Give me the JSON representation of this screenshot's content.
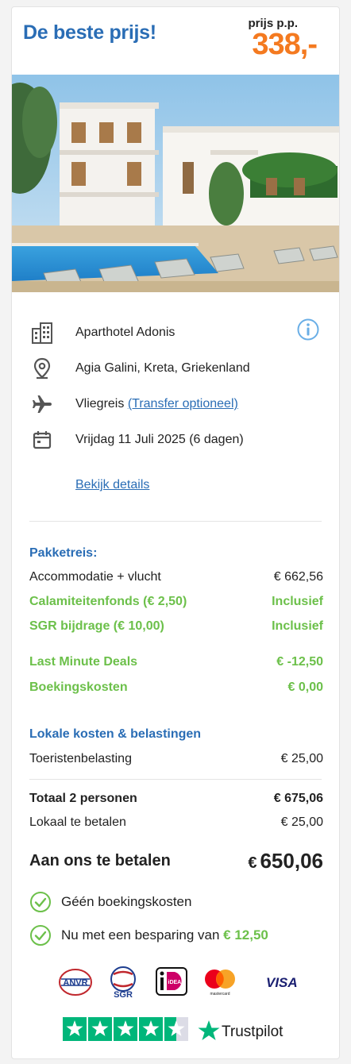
{
  "header": {
    "title": "De beste prijs!",
    "price_label": "prijs p.p.",
    "price_value": "338,-"
  },
  "hotel": {
    "name": "Aparthotel Adonis",
    "location": "Agia Galini, Kreta, Griekenland",
    "travel": "Vliegreis",
    "transfer_link": "(Transfer optioneel)",
    "date": "Vrijdag 11 Juli 2025 (6 dagen)",
    "details_link": "Bekijk details"
  },
  "package": {
    "heading": "Pakketreis:",
    "rows": [
      {
        "label": "Accommodatie + vlucht",
        "value": "€ 662,56"
      },
      {
        "label": "Calamiteitenfonds (€ 2,50)",
        "value": "Inclusief"
      },
      {
        "label": "SGR bijdrage (€ 10,00)",
        "value": "Inclusief"
      },
      {
        "label": "Last Minute Deals",
        "value": "€ -12,50"
      },
      {
        "label": "Boekingskosten",
        "value": "€ 0,00"
      }
    ]
  },
  "local": {
    "heading": "Lokale kosten & belastingen",
    "rows": [
      {
        "label": "Toeristenbelasting",
        "value": "€ 25,00"
      }
    ]
  },
  "totals": {
    "total_label": "Totaal 2 personen",
    "total_value": "€ 675,06",
    "local_label": "Lokaal te betalen",
    "local_value": "€ 25,00",
    "pay_label": "Aan ons te betalen",
    "pay_currency": "€",
    "pay_value": "650,06"
  },
  "benefits": {
    "no_fees": "Géén boekingskosten",
    "saving_text": "Nu met een besparing van",
    "saving_amount": "€ 12,50"
  },
  "payment_logos": {
    "anvr": "ANVR",
    "sgr": "SGR",
    "ideal": "iDEAL",
    "mastercard": "mastercard",
    "visa": "VISA"
  },
  "trustpilot": {
    "name": "Trustpilot",
    "stars": 4.5
  },
  "colors": {
    "brand_blue": "#2a6db5",
    "price_orange": "#f47a20",
    "green": "#6cc04a"
  }
}
